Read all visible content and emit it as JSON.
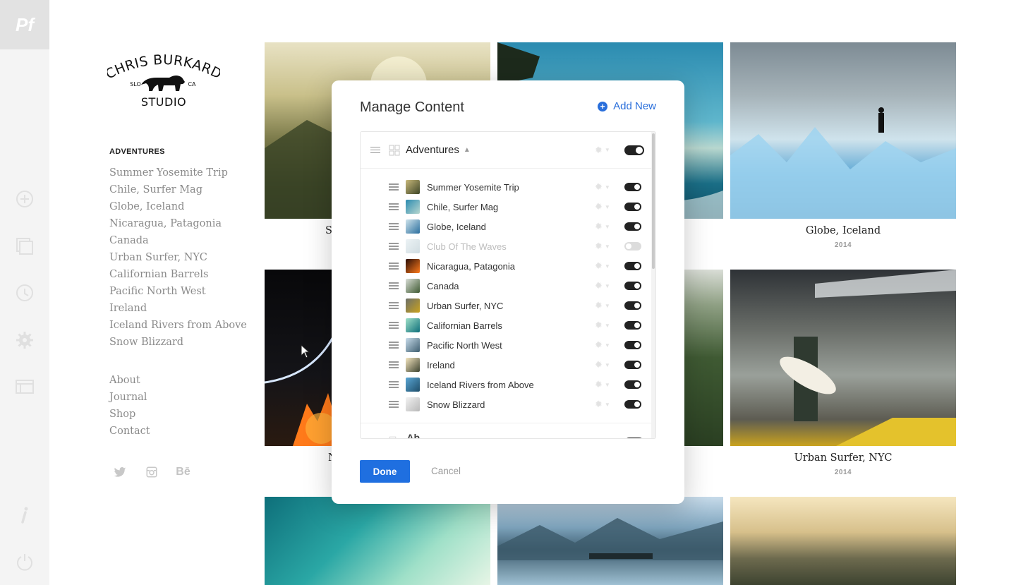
{
  "app": {
    "logo": "Pf"
  },
  "site": {
    "brand": {
      "line1": "CHRIS BURKARD",
      "left_tag": "SLO",
      "right_tag": "CA",
      "line2": "STUDIO"
    },
    "nav_heading": "ADVENTURES",
    "albums": [
      "Summer Yosemite Trip",
      "Chile, Surfer Mag",
      "Globe, Iceland",
      "Nicaragua, Patagonia",
      "Canada",
      "Urban Surfer, NYC",
      "Californian Barrels",
      "Pacific North West",
      "Ireland",
      "Iceland Rivers from Above",
      "Snow Blizzard"
    ],
    "pages": [
      "About",
      "Journal",
      "Shop",
      "Contact"
    ],
    "social": [
      "twitter-icon",
      "instagram-icon",
      "behance-icon"
    ],
    "social_glyphs": [
      "🐦",
      "◻",
      "Bē"
    ]
  },
  "gallery": {
    "captions": [
      {
        "title": "Globe, Iceland",
        "year": "2014"
      },
      {
        "title": "Urban Surfer, NYC",
        "year": "2014"
      }
    ],
    "partial_captions": [
      "S",
      "N"
    ]
  },
  "modal": {
    "title": "Manage Content",
    "add_new": "Add New",
    "group": {
      "label": "Adventures",
      "enabled": true
    },
    "items": [
      {
        "label": "Summer Yosemite Trip",
        "enabled": true
      },
      {
        "label": "Chile, Surfer Mag",
        "enabled": true
      },
      {
        "label": "Globe, Iceland",
        "enabled": true
      },
      {
        "label": "Club Of The Waves",
        "enabled": false
      },
      {
        "label": "Nicaragua, Patagonia",
        "enabled": true
      },
      {
        "label": "Canada",
        "enabled": true
      },
      {
        "label": "Urban Surfer, NYC",
        "enabled": true
      },
      {
        "label": "Californian Barrels",
        "enabled": true
      },
      {
        "label": "Pacific North West",
        "enabled": true
      },
      {
        "label": "Ireland",
        "enabled": true
      },
      {
        "label": "Iceland Rivers from Above",
        "enabled": true
      },
      {
        "label": "Snow Blizzard",
        "enabled": true
      }
    ],
    "next_group_partial": "Ab",
    "done": "Done",
    "cancel": "Cancel"
  },
  "colors": {
    "accent": "#1f6fe0",
    "link": "#2a6fdb",
    "toggle_on": "#222222",
    "toggle_off": "#dcdcdc"
  }
}
